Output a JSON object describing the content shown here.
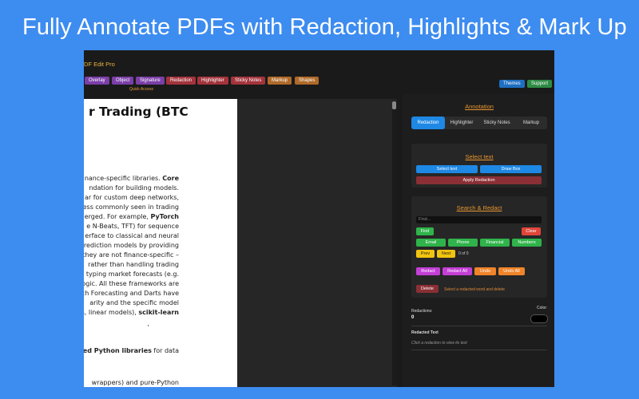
{
  "headline": "Fully Annotate PDFs with Redaction, Highlights & Mark Up",
  "app": {
    "title": "DF Edit Pro",
    "toolbar_chips": [
      {
        "label": "Overlay",
        "color": "#7b3fa8"
      },
      {
        "label": "Object",
        "color": "#7b3fa8"
      },
      {
        "label": "Signature",
        "color": "#7b3fa8"
      },
      {
        "label": "Redaction",
        "color": "#a3343c"
      },
      {
        "label": "Highlighter",
        "color": "#a3343c"
      },
      {
        "label": "Sticky Notes",
        "color": "#a3343c"
      },
      {
        "label": "Markup",
        "color": "#b06a2a"
      },
      {
        "label": "Shapes",
        "color": "#b06a2a"
      }
    ],
    "quick_access": "Quick Access",
    "themes_label": "Themes",
    "support_label": "Support"
  },
  "document": {
    "heading": "r Trading (BTC",
    "lines": [
      {
        "pre": "finance-specific libraries. ",
        "bold": "Core",
        "post": ""
      },
      {
        "pre": "ndation for building models.",
        "bold": "",
        "post": ""
      },
      {
        "pre": "ar for custom deep networks,",
        "bold": "",
        "post": ""
      },
      {
        "pre": "ess commonly seen in trading",
        "bold": "",
        "post": ""
      },
      {
        "pre": "erged. For example, ",
        "bold": "PyTorch",
        "post": ""
      },
      {
        "pre": "e N-Beats, TFT) for sequence",
        "bold": "",
        "post": ""
      },
      {
        "pre": "erface to classical and neural",
        "bold": "",
        "post": ""
      },
      {
        "pre": "prediction models by providing",
        "bold": "",
        "post": ""
      },
      {
        "pre": "they are not finance-specific –",
        "bold": "",
        "post": ""
      },
      {
        "pre": "rather than handling trading",
        "bold": "",
        "post": ""
      },
      {
        "pre": "typing market forecasts (e.g.",
        "bold": "",
        "post": ""
      },
      {
        "pre": "ogic. All these frameworks are",
        "bold": "",
        "post": ""
      },
      {
        "pre": "ch Forecasting and Darts have",
        "bold": "",
        "post": ""
      },
      {
        "pre": "arity and the specific model",
        "bold": "",
        "post": ""
      },
      {
        "pre": "es, linear models), ",
        "bold": "scikit-learn",
        "post": ""
      },
      {
        "pre": ",",
        "bold": "",
        "post": ""
      }
    ],
    "libraries_line": {
      "bold": "ed Python libraries",
      "post": " for data"
    },
    "last_line": "wrappers) and pure-Python"
  },
  "annotation": {
    "title": "Annotation",
    "tabs": [
      "Redaction",
      "Highlighter",
      "Sticky Notes",
      "Markup"
    ],
    "active_tab": 0,
    "select_text": {
      "title": "Select text",
      "select_btn": "Select text",
      "draw_btn": "Draw Box",
      "apply_btn": "Apply Redaction"
    },
    "search": {
      "title": "Search & Redact",
      "placeholder": "Find...",
      "find_btn": "Find",
      "clear_btn": "Clear",
      "filters": [
        "Email",
        "Phone",
        "Financial",
        "Numbers"
      ],
      "prev_btn": "Prev",
      "next_btn": "Next",
      "match_count": "0 of 0",
      "redact_btn": "Redact",
      "redact_all_btn": "Redact All",
      "undo_btn": "Undo",
      "undo_all_btn": "Undo All",
      "delete_btn": "Delete",
      "delete_hint": "Select a redacted word and delete"
    },
    "redactions_label": "Redactions:",
    "redactions_count": "0",
    "color_label": "Color:",
    "redacted_text_label": "Redacted Text",
    "redacted_text_hint": "Click a redaction to view its text"
  }
}
